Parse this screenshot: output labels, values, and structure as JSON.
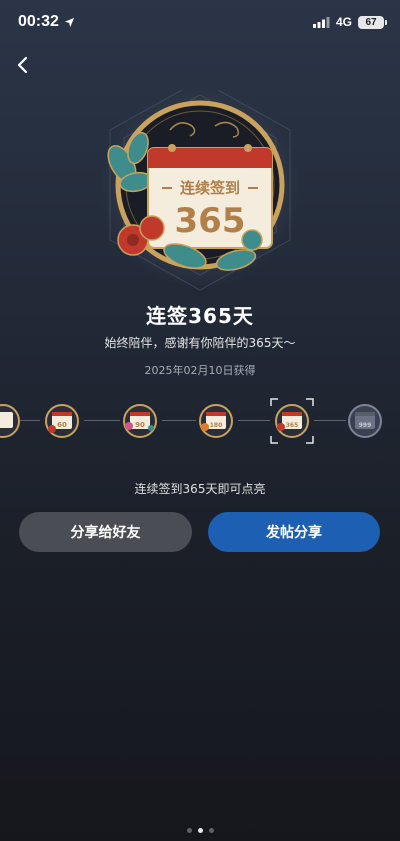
{
  "status_bar": {
    "time": "00:32",
    "network": "4G",
    "battery": "67"
  },
  "badge": {
    "calendar_label": "连续签到",
    "number": "365",
    "title": "连签365天",
    "description": "始终陪伴，感谢有你陪伴的365天～",
    "earned_date": "2025年02月10日获得"
  },
  "carousel": {
    "items": [
      {
        "id": "30",
        "number": "",
        "selected": false,
        "locked": false
      },
      {
        "id": "60",
        "number": "60",
        "selected": false,
        "locked": false
      },
      {
        "id": "90",
        "number": "90",
        "selected": false,
        "locked": false
      },
      {
        "id": "180",
        "number": "180",
        "selected": false,
        "locked": false
      },
      {
        "id": "365",
        "number": "365",
        "selected": true,
        "locked": false
      },
      {
        "id": "999",
        "number": "999",
        "selected": false,
        "locked": true
      }
    ]
  },
  "unlock_hint": "连续签到365天即可点亮",
  "buttons": {
    "share_friend": "分享给好友",
    "post_share": "发帖分享"
  },
  "pager": {
    "count": 3,
    "active": 1
  },
  "colors": {
    "accent_blue": "#1c5fb3",
    "badge_gold": "#c9a25e",
    "badge_red": "#c0392b",
    "badge_teal": "#3f8c8c"
  }
}
